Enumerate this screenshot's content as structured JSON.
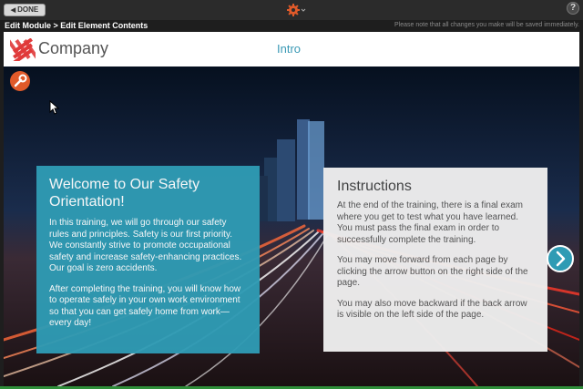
{
  "toolbar": {
    "done_label": "DONE",
    "help_label": "?",
    "icons": {
      "back": "left-arrow-icon",
      "settings": "gear-icon",
      "help": "question-icon"
    },
    "accent_color": "#e05a2a"
  },
  "breadcrumb": {
    "text": "Edit Module > Edit Element Contents"
  },
  "save_notice": "Please note that all changes you make will be saved immediately.",
  "course": {
    "brand": "Company",
    "page_title": "Intro",
    "brand_color": "#e03a3a",
    "accent": "#2f9bb4"
  },
  "welcome": {
    "heading": "Welcome to Our Safety Orientation!",
    "para1": "In this training, we will go through our safety rules and principles. Safety is our first priority. We constantly strive to promote occupational safety and increase safety-enhancing practices. Our goal is zero accidents.",
    "para2": "After completing the training, you will know how to operate safely in your own work environment so that you can get safely home from work—every day!"
  },
  "instructions": {
    "heading": "Instructions",
    "para1": "At the end of the training, there is a final exam where you get to test what you have learned. You must pass the final exam in order to successfully complete the training.",
    "para2": "You may move forward from each page by clicking the arrow button on the right side of the page.",
    "para3": "You may also move backward if the back arrow is visible on the left side of the page."
  }
}
